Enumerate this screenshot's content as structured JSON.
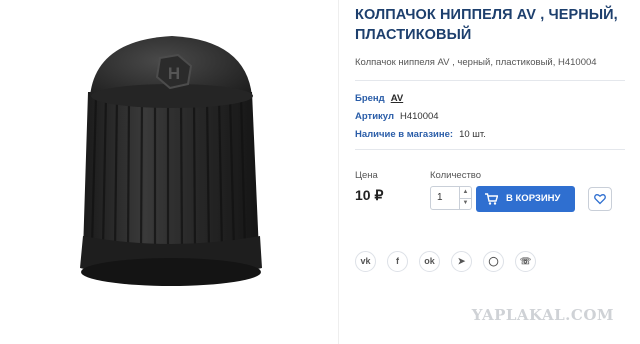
{
  "product": {
    "title": "КОЛПАЧОК НИППЕЛЯ AV , ЧЕРНЫЙ, ПЛАСТИКОВЫЙ",
    "description": "Колпачок ниппеля AV , черный, пластиковый, H410004",
    "image_icon": "valve-cap-photo",
    "properties": [
      {
        "key": "Бренд",
        "value": "AV"
      },
      {
        "key": "Артикул",
        "value": "H410004"
      },
      {
        "key": "Наличие в магазине:",
        "value": "10 шт."
      }
    ]
  },
  "purchase": {
    "price_label": "Цена",
    "price": "10 ₽",
    "qty_label": "Количество",
    "qty_value": "1",
    "cart_label": "В КОРЗИНУ",
    "accent_color": "#2f6fd0"
  },
  "socials": [
    "vk-icon",
    "facebook-icon",
    "odnoklassniki-icon",
    "telegram-icon",
    "whatsapp-icon",
    "viber-icon"
  ],
  "watermark": "YAPLAKAL.COM"
}
